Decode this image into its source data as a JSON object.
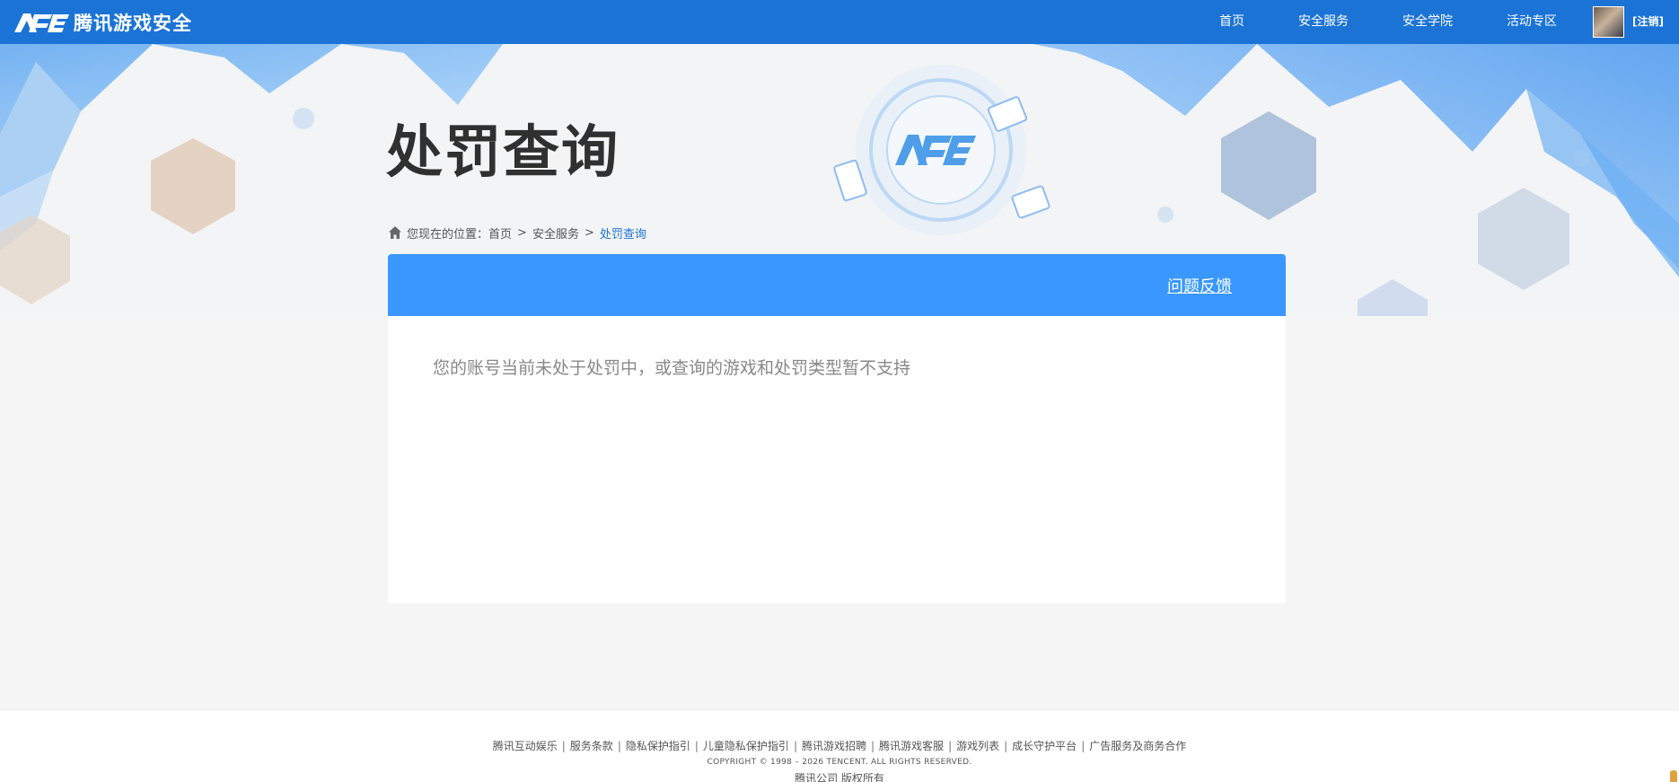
{
  "header": {
    "logo_text": "腾讯游戏安全",
    "nav": [
      {
        "label": "首页"
      },
      {
        "label": "安全服务"
      },
      {
        "label": "安全学院"
      },
      {
        "label": "活动专区"
      }
    ],
    "logout_label": "[注销]"
  },
  "page": {
    "title": "处罚查询"
  },
  "breadcrumb": {
    "prefix": "您现在的位置：",
    "items": [
      "首页",
      "安全服务",
      "处罚查询"
    ],
    "separator": ">"
  },
  "panel": {
    "feedback_label": "问题反馈",
    "message": "您的账号当前未处于处罚中，或查询的游戏和处罚类型暂不支持"
  },
  "footer": {
    "links": [
      "腾讯互动娱乐",
      "服务条款",
      "隐私保护指引",
      "儿童隐私保护指引",
      "腾讯游戏招聘",
      "腾讯游戏客服",
      "游戏列表",
      "成长守护平台",
      "广告服务及商务合作"
    ],
    "copyright": "COPYRIGHT © 1998 – 2026 TENCENT. ALL RIGHTS RESERVED.",
    "company": "腾讯公司 版权所有"
  },
  "colors": {
    "topbar": "#1b73d6",
    "panel_header": "#3a97fe",
    "accent_text": "#1b73d6"
  },
  "icons": {
    "logo": "ace-logo-icon",
    "home": "home-icon",
    "avatar": "user-avatar"
  }
}
